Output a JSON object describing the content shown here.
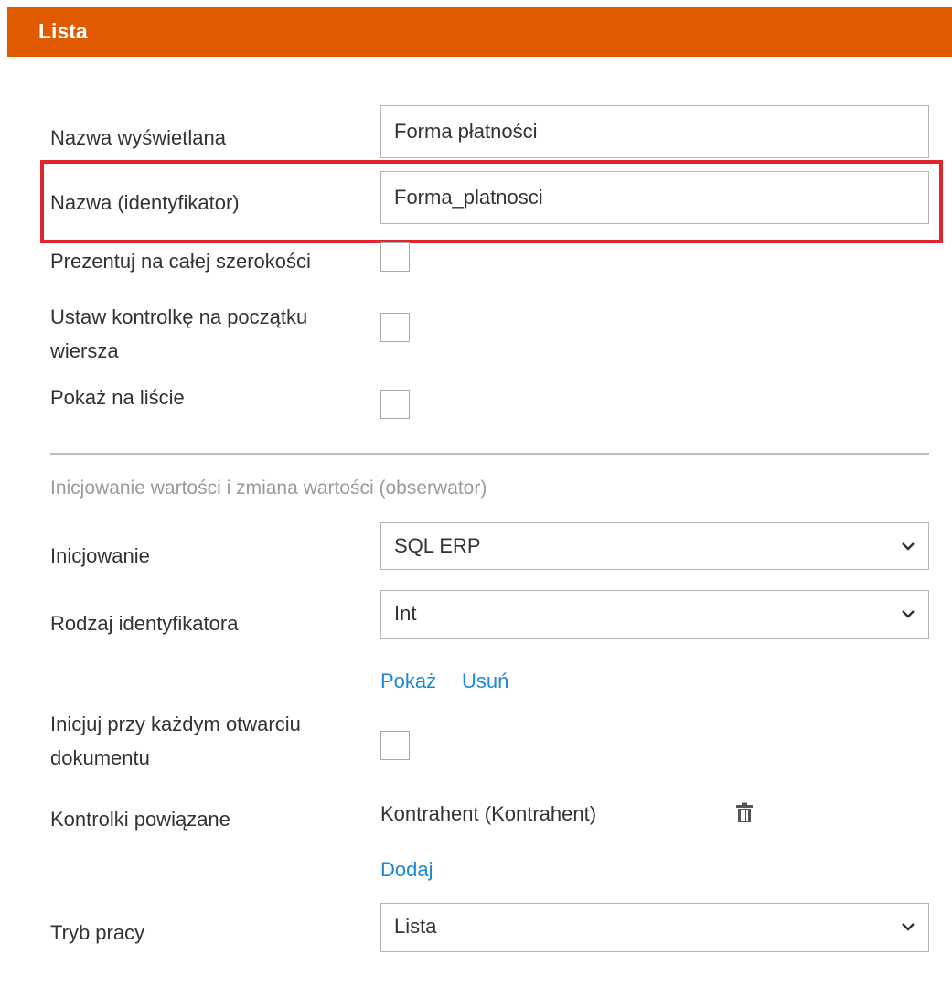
{
  "header": {
    "title": "Lista"
  },
  "fields": {
    "display_name": {
      "label": "Nazwa wyświetlana",
      "value": "Forma płatności"
    },
    "identifier": {
      "label": "Nazwa (identyfikator)",
      "value": "Forma_platnosci"
    }
  },
  "checkboxes": {
    "full_width": {
      "label": "Prezentuj na całej szerokości",
      "checked": false
    },
    "row_start": {
      "label_line1": "Ustaw kontrolkę na początku",
      "label_line2": "wiersza",
      "checked": false
    },
    "show_on_list": {
      "label": "Pokaż na liście",
      "checked": false
    }
  },
  "section": {
    "title": "Inicjowanie wartości i zmiana wartości (obserwator)"
  },
  "selects": {
    "init": {
      "label": "Inicjowanie",
      "value": "SQL ERP"
    },
    "id_type": {
      "label": "Rodzaj identyfikatora",
      "value": "Int"
    },
    "work_mode": {
      "label": "Tryb pracy",
      "value": "Lista"
    }
  },
  "links": {
    "show": "Pokaż",
    "remove": "Usuń",
    "add": "Dodaj"
  },
  "init_each_open": {
    "label_line1": "Inicjuj przy każdym otwarciu",
    "label_line2": "dokumentu",
    "checked": false
  },
  "related": {
    "label": "Kontrolki powiązane",
    "item": "Kontrahent (Kontrahent)",
    "icon": "trash-icon"
  },
  "colors": {
    "header": "#e05a00",
    "highlight": "#e1242d",
    "link": "#1e88d4"
  }
}
